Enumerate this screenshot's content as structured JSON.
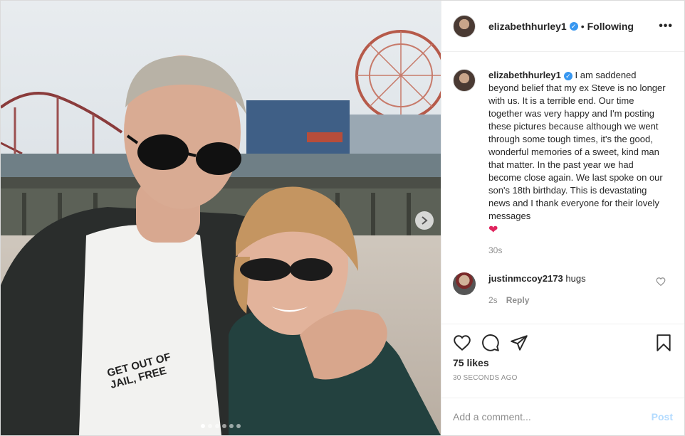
{
  "post": {
    "username": "elizabethhurley1",
    "separator": "•",
    "follow_state": "Following",
    "more_label": "•••",
    "caption_user": "elizabethhurley1",
    "caption_text": "I am saddened beyond belief that my ex Steve is no longer with us. It is a terrible end. Our time together was very happy and I'm posting these pictures because although we went through some tough times, it's the good, wonderful memories of a sweet, kind man that matter. In the past year we had become close again. We last spoke on our son's 18th birthday. This is devastating news and I thank everyone for their lovely messages",
    "caption_emoji": "❤",
    "caption_time": "30s",
    "photo_shirt_text": "GET OUT OF JAIL, FREE",
    "carousel_dots": 6,
    "carousel_active": 0
  },
  "comments": [
    {
      "username": "justinmccoy2173",
      "text": "hugs",
      "time": "2s",
      "reply_label": "Reply"
    }
  ],
  "footer": {
    "likes": "75 likes",
    "posted": "30 SECONDS AGO",
    "comment_placeholder": "Add a comment...",
    "post_label": "Post"
  },
  "colors": {
    "verified": "#3897f0",
    "post_button": "#b3dbff",
    "heart": "#e0245e"
  }
}
